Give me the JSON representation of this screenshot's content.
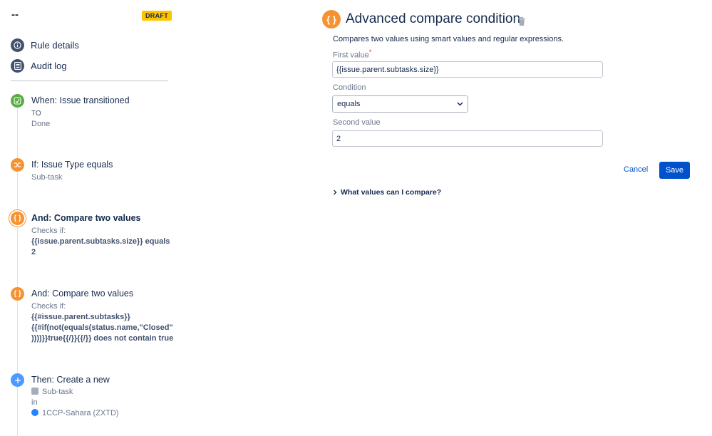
{
  "rule": {
    "title": "--",
    "status_badge": "DRAFT"
  },
  "nav": {
    "rule_details": "Rule details",
    "audit_log": "Audit log"
  },
  "steps": {
    "trigger": {
      "title": "When: Issue transitioned",
      "to_label": "TO",
      "to_value": "Done",
      "icon": "transition-icon",
      "color": "#5aac44"
    },
    "if": {
      "title": "If: Issue Type equals",
      "value": "Sub-task",
      "icon": "shuffle-icon",
      "color": "#f79232"
    },
    "and1": {
      "title": "And: Compare two values",
      "checks": "Checks if:",
      "line1": "{{issue.parent.subtasks.size}} equals",
      "line2": "2",
      "icon": "braces-icon",
      "color": "#f79232"
    },
    "and2": {
      "title": "And: Compare two values",
      "checks": "Checks if:",
      "line1": "{{#issue.parent.subtasks}}",
      "line2": "{{#if(not(equals(status.name,\"Closed\"",
      "line3": "))))}}true{{/}}{{/}} does not contain true",
      "icon": "braces-icon",
      "color": "#f79232"
    },
    "then": {
      "title": "Then: Create a new",
      "issue_type": "Sub-task",
      "in_label": "in",
      "project": "1CCP-Sahara (ZXTD)",
      "icon": "plus-icon",
      "color": "#4c9aff"
    }
  },
  "panel": {
    "icon_glyph": "{ }",
    "title": "Advanced compare condition",
    "description": "Compares two values using smart values and regular expressions.",
    "first_value_label": "First value",
    "required_mark": "*",
    "first_value": "{{issue.parent.subtasks.size}}",
    "condition_label": "Condition",
    "condition_value": "equals",
    "second_value_label": "Second value",
    "second_value": "2",
    "cancel": "Cancel",
    "save": "Save",
    "help_toggle": "What values can I compare?"
  },
  "colors": {
    "accent": "#0052cc",
    "draft": "#ffc400",
    "trigger": "#5aac44",
    "condition": "#f79232",
    "action": "#4c9aff"
  }
}
